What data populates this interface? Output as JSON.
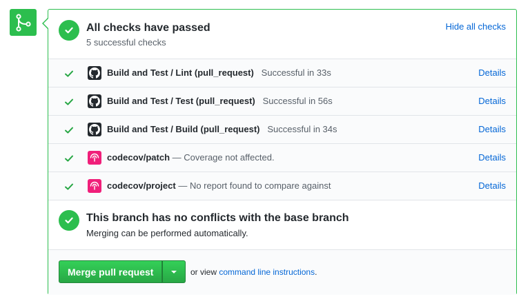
{
  "header": {
    "title": "All checks have passed",
    "subtitle": "5 successful checks",
    "hide_link": "Hide all checks"
  },
  "checks": [
    {
      "logo": "github-icon",
      "name": "Build and Test / Lint (pull_request)",
      "description": "Successful in 33s",
      "details": "Details"
    },
    {
      "logo": "github-icon",
      "name": "Build and Test / Test (pull_request)",
      "description": "Successful in 56s",
      "details": "Details"
    },
    {
      "logo": "github-icon",
      "name": "Build and Test / Build (pull_request)",
      "description": "Successful in 34s",
      "details": "Details"
    },
    {
      "logo": "codecov-icon",
      "name": "codecov/patch",
      "description": "— Coverage not affected.",
      "details": "Details"
    },
    {
      "logo": "codecov-icon",
      "name": "codecov/project",
      "description": "— No report found to compare against",
      "details": "Details"
    }
  ],
  "branch": {
    "title": "This branch has no conflicts with the base branch",
    "subtitle": "Merging can be performed automatically."
  },
  "merge": {
    "button_label": "Merge pull request",
    "hint_prefix": "or view",
    "hint_link": "command line instructions",
    "hint_suffix": "."
  },
  "colors": {
    "success": "#2cbe4e",
    "link": "#0366d6",
    "codecov": "#f01f7a",
    "github": "#24292e"
  }
}
